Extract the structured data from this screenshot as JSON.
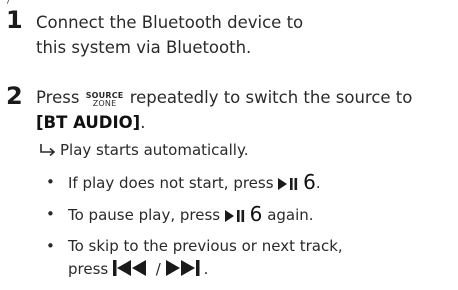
{
  "top_fragment": "/",
  "steps": [
    {
      "number": "1",
      "text": "Connect the Bluetooth device to this system via Bluetooth."
    },
    {
      "number": "2",
      "text_before": "Press",
      "source_key_top": "SOURCE",
      "source_key_bottom": "ZONE",
      "text_after": "repeatedly to switch the source to",
      "source_value": "[BT AUDIO]",
      "text_end": ".",
      "result": "Play starts automatically.",
      "bullets": [
        {
          "text_before": "If play does not start, press",
          "key_number": "6",
          "text_after": "."
        },
        {
          "text_before": "To pause play, press",
          "key_number": "6",
          "text_after": "again."
        },
        {
          "text_before": "To skip to the previous or next track, press",
          "separator": "/",
          "text_after": "."
        }
      ]
    }
  ],
  "icons": {
    "result_arrow": "result-arrow-icon",
    "play_pause": "play-pause-icon",
    "previous": "previous-track-icon",
    "next": "next-track-icon"
  },
  "colors": {
    "text": "#2a2a2a",
    "heading": "#1a1a1a"
  }
}
